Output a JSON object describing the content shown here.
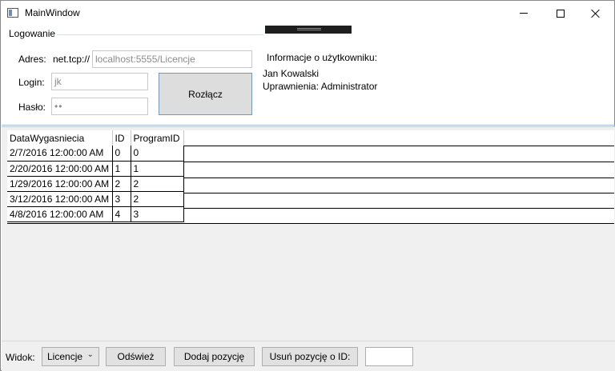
{
  "window": {
    "title": "MainWindow"
  },
  "login_group": {
    "legend": "Logowanie",
    "address_label": "Adres:",
    "address_prefix": "net.tcp://",
    "address_value": "localhost:5555/Licencje",
    "login_label": "Login:",
    "login_value": "jk",
    "password_label": "Hasło:",
    "password_value": "••",
    "disconnect_button": "Rozłącz"
  },
  "user_info": {
    "heading": "Informacje o użytkowniku:",
    "name": "Jan Kowalski",
    "permissions": "Uprawnienia: Administrator"
  },
  "grid": {
    "columns": [
      "DataWygasniecia",
      "ID",
      "ProgramID"
    ],
    "rows": [
      [
        "2/7/2016 12:00:00 AM",
        "0",
        "0"
      ],
      [
        "2/20/2016 12:00:00 AM",
        "1",
        "1"
      ],
      [
        "1/29/2016 12:00:00 AM",
        "2",
        "2"
      ],
      [
        "3/12/2016 12:00:00 AM",
        "3",
        "2"
      ],
      [
        "4/8/2016 12:00:00 AM",
        "4",
        "3"
      ]
    ]
  },
  "bottom_bar": {
    "view_label": "Widok:",
    "view_selected": "Licencje",
    "refresh_button": "Odśwież",
    "add_button": "Dodaj pozycję",
    "remove_button": "Usuń pozycję o ID:",
    "id_value": ""
  }
}
